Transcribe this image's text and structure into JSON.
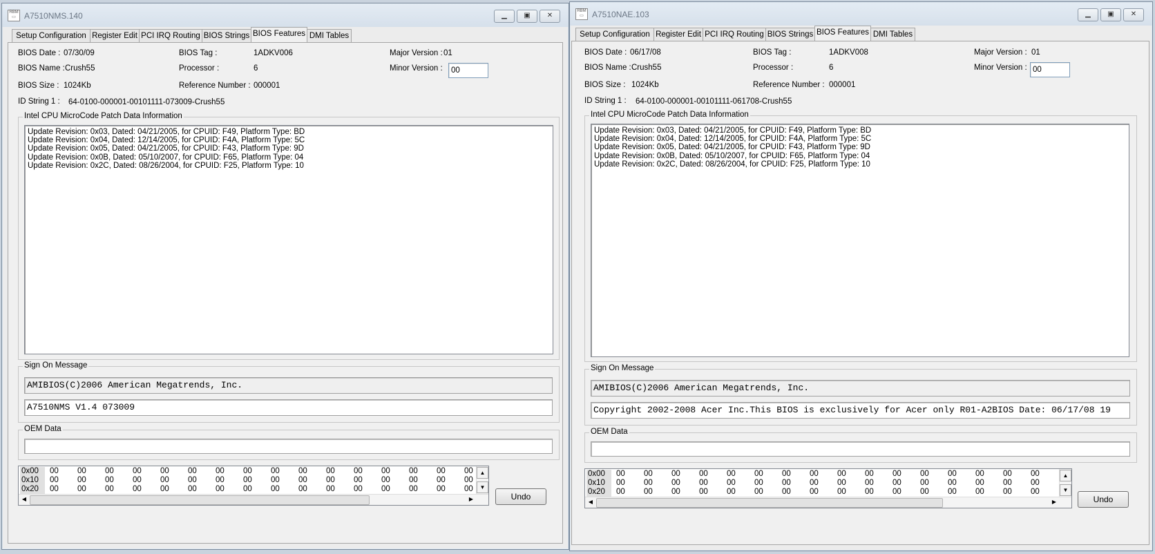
{
  "windows": [
    {
      "title": "A7510NMS.140",
      "tabs": [
        "Setup Configuration",
        "Register Edit",
        "PCI IRQ Routing",
        "BIOS Strings",
        "BIOS Features",
        "DMI Tables"
      ],
      "active_tab": "BIOS Features",
      "labels": {
        "bios_date": "BIOS Date :",
        "bios_tag": "BIOS Tag :",
        "major_version": "Major Version :",
        "bios_name": "BIOS Name :",
        "processor": "Processor :",
        "minor_version": "Minor Version :",
        "bios_size": "BIOS Size :",
        "reference_number": "Reference Number :",
        "id_string": "ID String 1 :"
      },
      "values": {
        "bios_date": "07/30/09",
        "bios_tag": "1ADKV006",
        "major_version": "01",
        "bios_name": "Crush55",
        "processor": "6",
        "minor_version": "00",
        "bios_size": "1024Kb",
        "reference_number": "000001",
        "id_string": "64-0100-000001-00101111-073009-Crush55"
      },
      "microcode_group": "Intel CPU MicroCode Patch Data Information",
      "microcode_lines": [
        "Update Revision: 0x03, Dated: 04/21/2005, for CPUID: F49, Platform Type: BD",
        "Update Revision: 0x04, Dated: 12/14/2005, for CPUID: F4A, Platform Type: 5C",
        "Update Revision: 0x05, Dated: 04/21/2005, for CPUID: F43, Platform Type: 9D",
        "Update Revision: 0x0B, Dated: 05/10/2007, for CPUID: F65, Platform Type: 04",
        "Update Revision: 0x2C, Dated: 08/26/2004, for CPUID: F25, Platform Type: 10"
      ],
      "sign_on_group": "Sign On Message",
      "sign_on_line1": "AMIBIOS(C)2006 American Megatrends, Inc.",
      "sign_on_line2": "A7510NMS V1.4 073009",
      "oem_group": "OEM Data",
      "oem_value": "",
      "grid_rows": [
        {
          "addr": "0x00",
          "cells": [
            "00",
            "00",
            "00",
            "00",
            "00",
            "00",
            "00",
            "00",
            "00",
            "00",
            "00",
            "00",
            "00",
            "00",
            "00",
            "00"
          ]
        },
        {
          "addr": "0x10",
          "cells": [
            "00",
            "00",
            "00",
            "00",
            "00",
            "00",
            "00",
            "00",
            "00",
            "00",
            "00",
            "00",
            "00",
            "00",
            "00",
            "00"
          ]
        },
        {
          "addr": "0x20",
          "cells": [
            "00",
            "00",
            "00",
            "00",
            "00",
            "00",
            "00",
            "00",
            "00",
            "00",
            "00",
            "00",
            "00",
            "00",
            "00",
            "00"
          ]
        }
      ],
      "undo_label": "Undo"
    },
    {
      "title": "A7510NAE.103",
      "tabs": [
        "Setup Configuration",
        "Register Edit",
        "PCI IRQ Routing",
        "BIOS Strings",
        "BIOS Features",
        "DMI Tables"
      ],
      "active_tab": "BIOS Features",
      "labels": {
        "bios_date": "BIOS Date :",
        "bios_tag": "BIOS Tag :",
        "major_version": "Major Version :",
        "bios_name": "BIOS Name :",
        "processor": "Processor :",
        "minor_version": "Minor Version :",
        "bios_size": "BIOS Size :",
        "reference_number": "Reference Number :",
        "id_string": "ID String 1 :"
      },
      "values": {
        "bios_date": "06/17/08",
        "bios_tag": "1ADKV008",
        "major_version": "01",
        "bios_name": "Crush55",
        "processor": "6",
        "minor_version": "00",
        "bios_size": "1024Kb",
        "reference_number": "000001",
        "id_string": "64-0100-000001-00101111-061708-Crush55"
      },
      "microcode_group": "Intel CPU MicroCode Patch Data Information",
      "microcode_lines": [
        "Update Revision: 0x03, Dated: 04/21/2005, for CPUID: F49, Platform Type: BD",
        "Update Revision: 0x04, Dated: 12/14/2005, for CPUID: F4A, Platform Type: 5C",
        "Update Revision: 0x05, Dated: 04/21/2005, for CPUID: F43, Platform Type: 9D",
        "Update Revision: 0x0B, Dated: 05/10/2007, for CPUID: F65, Platform Type: 04",
        "Update Revision: 0x2C, Dated: 08/26/2004, for CPUID: F25, Platform Type: 10"
      ],
      "sign_on_group": "Sign On Message",
      "sign_on_line1": "AMIBIOS(C)2006 American Megatrends, Inc.",
      "sign_on_line2": "Copyright 2002-2008 Acer Inc.This BIOS is exclusively for Acer only R01-A2BIOS Date: 06/17/08 19",
      "oem_group": "OEM Data",
      "oem_value": "",
      "grid_rows": [
        {
          "addr": "0x00",
          "cells": [
            "00",
            "00",
            "00",
            "00",
            "00",
            "00",
            "00",
            "00",
            "00",
            "00",
            "00",
            "00",
            "00",
            "00",
            "00",
            "00"
          ]
        },
        {
          "addr": "0x10",
          "cells": [
            "00",
            "00",
            "00",
            "00",
            "00",
            "00",
            "00",
            "00",
            "00",
            "00",
            "00",
            "00",
            "00",
            "00",
            "00",
            "00"
          ]
        },
        {
          "addr": "0x20",
          "cells": [
            "00",
            "00",
            "00",
            "00",
            "00",
            "00",
            "00",
            "00",
            "00",
            "00",
            "00",
            "00",
            "00",
            "00",
            "00",
            "00"
          ]
        }
      ],
      "undo_label": "Undo"
    }
  ]
}
